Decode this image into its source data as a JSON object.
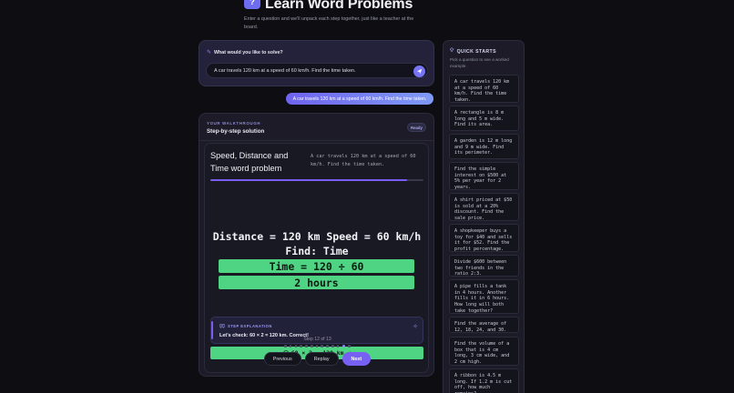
{
  "header": {
    "icon_label": "?",
    "title": "Learn Word Problems",
    "subtitle": "Enter a question and we'll unpack each step together, just like a teacher at the board."
  },
  "ask": {
    "label": "What would you like to solve?",
    "input_value": "A car travels 120 km at a speed of 60 km/h. Find the time taken."
  },
  "user_bubble": "A car travels 120 km at a speed of 60 km/h. Find the time taken.",
  "walkthrough": {
    "eyebrow": "YOUR WALKTHROUGH",
    "title": "Step-by-step solution",
    "status": "Ready",
    "board": {
      "title": "Speed, Distance and Time word problem",
      "problem": "A car travels 120 km at a speed of 60 km/h. Find the time taken.",
      "progress": 0.923,
      "line1": "Distance = 120 km  Speed = 60 km/h",
      "line2": "Find: Time",
      "line3": "Time = 120 ÷ 60",
      "line4": "2 hours"
    },
    "step": {
      "eyebrow": "STEP EXPLANATION",
      "text": "Let's check: 60 × 2 = 120 km. Correct!",
      "check": "60 × 2 = 120 km ✓"
    },
    "pagination": {
      "label": "Step 12 of 13",
      "current": 12,
      "total": 13
    },
    "buttons": {
      "previous": "Previous",
      "replay": "Replay",
      "next": "Next"
    }
  },
  "quick_starts": {
    "title": "QUICK STARTS",
    "subtitle": "Pick a question to see a worked example.",
    "items": [
      "A car travels 120 km at a speed of 60 km/h. Find the time taken.",
      "A rectangle is 8 m long and 5 m wide. Find its area.",
      "A garden is 12 m long and 9 m wide. Find its perimeter.",
      "Find the simple interest on $500 at 5% per year for 2 years.",
      "A shirt priced at $50 is sold at a 20% discount. Find the sale price.",
      "A shopkeeper buys a toy for $40 and sells it for $52. Find the profit percentage.",
      "Divide $600 between two friends in the ratio 2:3.",
      "A pipe fills a tank in 4 hours. Another fills it in 6 hours. How long will both take together?",
      "Find the average of 12, 18, 24, and 30.",
      "Find the volume of a box that is 4 cm long, 3 cm wide, and 2 cm high.",
      "A ribbon is 4.5 m long. If 1.2 m is cut off, how much remains?"
    ]
  },
  "colors": {
    "accent": "#7760f4",
    "highlight": "#4ed482",
    "background": "#0d0d12",
    "panel": "#1c1b27"
  },
  "icons": {
    "header": "question-icon",
    "ask": "pencil-icon",
    "send": "send-icon",
    "step": "board-icon",
    "check": "check-circle-icon",
    "quick_starts": "lightbulb-icon"
  }
}
